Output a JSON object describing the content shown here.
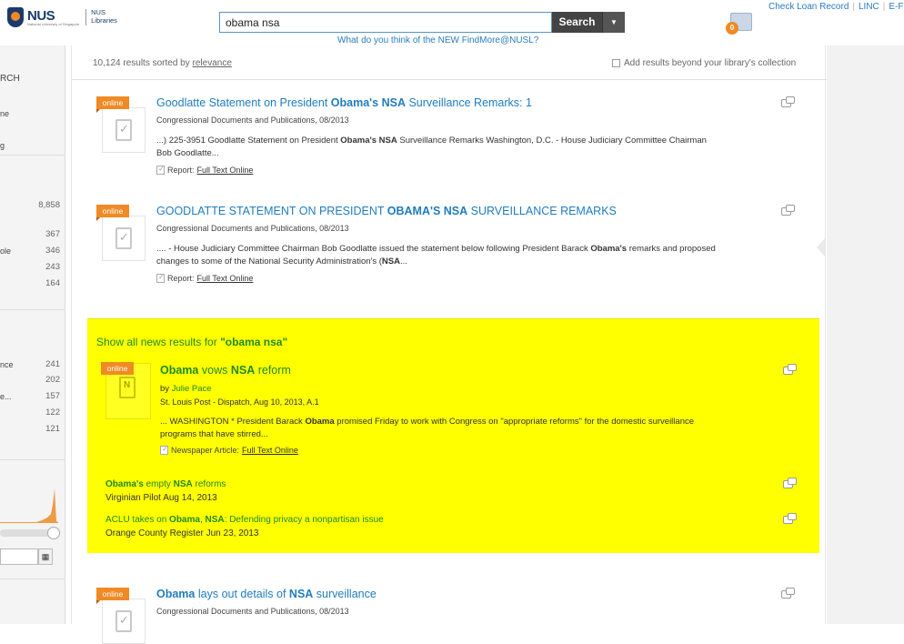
{
  "header": {
    "logo_text": "NUS",
    "logo_subtext": "National University of Singapore",
    "library_line1": "NUS",
    "library_line2": "Libraries",
    "search_value": "obama nsa",
    "search_button": "Search",
    "feedback_link": "What do you think of the NEW FindMore@NUSL?",
    "folder_count": "0",
    "top_links": [
      "Check Loan Record",
      "LINC",
      "E-F"
    ]
  },
  "sidebar": {
    "texts": [
      "RCH",
      "ne",
      "g",
      "ole",
      "nce",
      "e..."
    ],
    "counts_a": [
      "8,858",
      "367",
      "346",
      "243",
      "164"
    ],
    "counts_b": [
      "241",
      "202",
      "157",
      "122",
      "121"
    ]
  },
  "results_bar": {
    "count_text": "10,124 results sorted by",
    "sort_link": "relevance",
    "beyond_label": "Add results beyond your library's collection"
  },
  "records": [
    {
      "badge": "online",
      "title_pre": "Goodlatte Statement on President ",
      "title_b1": "Obama's",
      "title_mid": " ",
      "title_b2": "NSA",
      "title_post": " Surveillance Remarks: 1",
      "meta": "Congressional Documents and Publications, 08/2013",
      "snip_line1_pre": "...) 225-3951 Goodlatte Statement on President ",
      "snip_line1_b1": "Obama's NSA",
      "snip_line1_post": " Surveillance Remarks Washington, D.C. - House Judiciary Committee Chairman",
      "snip_line2": "Bob Goodlatte...",
      "type_label": "Report:",
      "link": "Full Text Online"
    },
    {
      "badge": "online",
      "title_pre": "GOODLATTE STATEMENT ON PRESIDENT ",
      "title_b1": "OBAMA'S",
      "title_mid": " ",
      "title_b2": "NSA",
      "title_post": " SURVEILLANCE REMARKS",
      "meta": "Congressional Documents and Publications, 08/2013",
      "snip_line1_pre": ".... - House Judiciary Committee Chairman Bob Goodlatte issued the statement below following President Barack ",
      "snip_line1_b1": "Obama's",
      "snip_line1_post": " remarks and proposed",
      "snip_line2_pre": "changes to some of the National Security Administration's (",
      "snip_line2_b": "NSA",
      "snip_line2_post": "...",
      "type_label": "Report:",
      "link": "Full Text Online"
    },
    {
      "badge": "online",
      "title_b1": "Obama",
      "title_mid": " lays out details of ",
      "title_b2": "NSA",
      "title_post": " surveillance",
      "meta": "Congressional Documents and Publications, 08/2013"
    }
  ],
  "news": {
    "head_pre": "Show all news results for ",
    "head_query": "\"obama nsa\"",
    "feature": {
      "badge": "online",
      "title_b1": "Obama",
      "title_mid": " vows ",
      "title_b2": "NSA",
      "title_post": " reform",
      "by_label": "by",
      "author": "Julie Pace",
      "source": "St. Louis Post - Dispatch, Aug 10, 2013, A.1",
      "snip_line1_pre": "...  WASHINGTON * President Barack ",
      "snip_line1_b": "Obama",
      "snip_line1_post": " promised Friday to work with Congress on \"appropriate reforms\" for the domestic surveillance",
      "snip_line2": "programs that have stirred...",
      "type_label": "Newspaper Article:",
      "link": "Full Text Online"
    },
    "items": [
      {
        "title_b1": "Obama's",
        "title_mid": " empty ",
        "title_b2": "NSA",
        "title_post": " reforms",
        "source": "Virginian Pilot  Aug 14, 2013"
      },
      {
        "title_pre": "ACLU takes on ",
        "title_b1": "Obama",
        "title_mid": ", ",
        "title_b2": "NSA",
        "title_post": ": Defending privacy a nonpartisan issue",
        "source": "Orange County Register  Jun 23, 2013"
      }
    ]
  }
}
